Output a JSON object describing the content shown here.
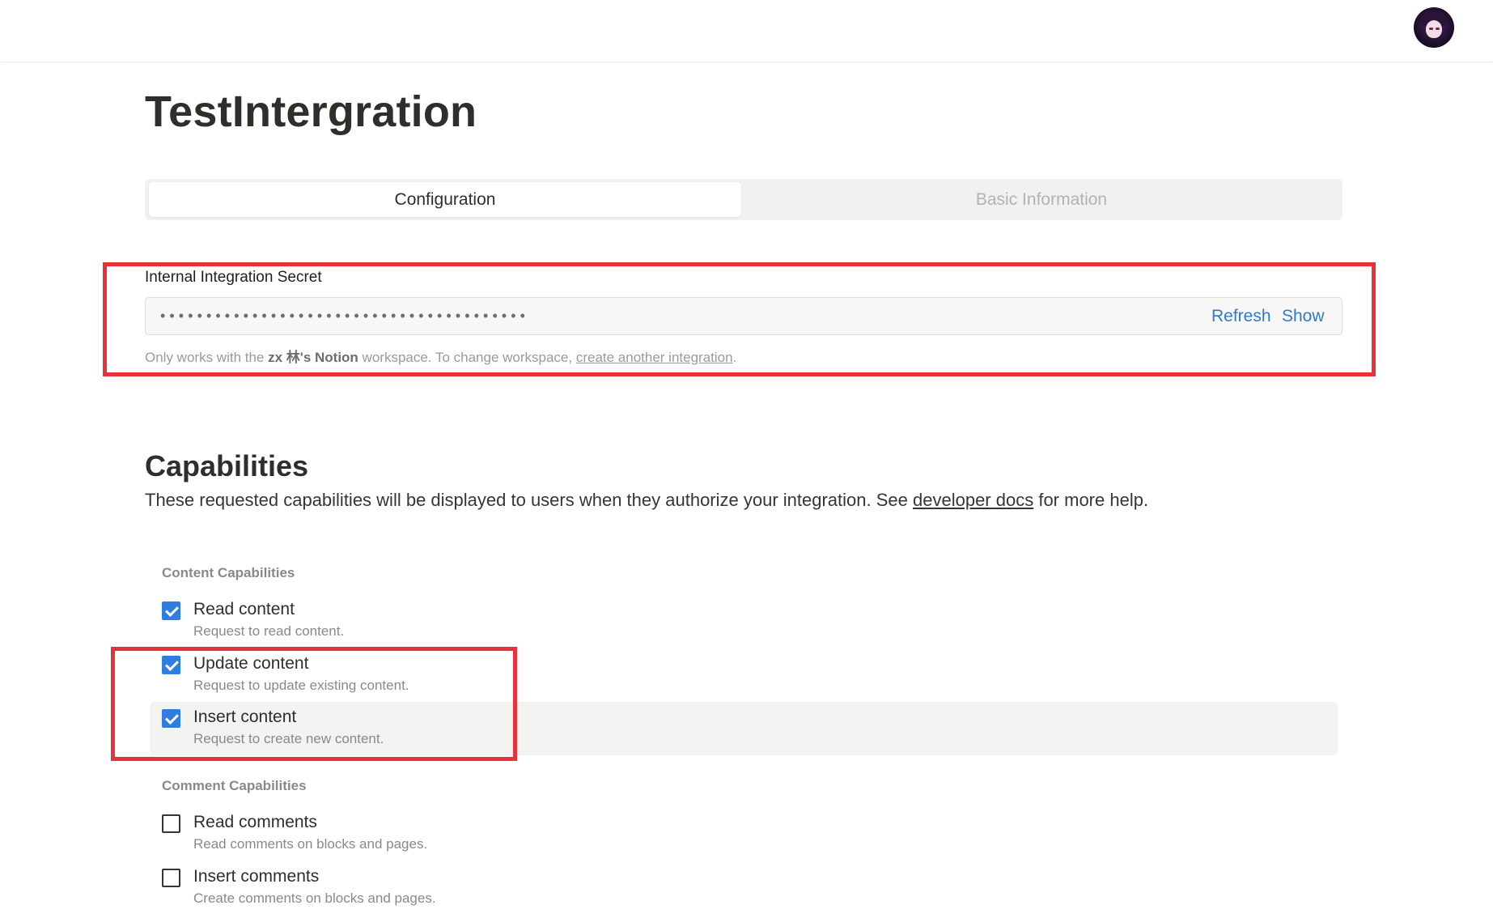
{
  "header": {
    "avatar_icon": "user-avatar"
  },
  "page": {
    "title": "TestIntergration"
  },
  "tabs": [
    {
      "label": "Configuration",
      "active": true
    },
    {
      "label": "Basic Information",
      "active": false
    }
  ],
  "secret": {
    "label": "Internal Integration Secret",
    "masked_value": "••••••••••••••••••••••••••••••••••••••••",
    "refresh_label": "Refresh",
    "show_label": "Show",
    "hint_prefix": "Only works with the ",
    "hint_workspace": "zx 林's Notion",
    "hint_middle": " workspace. To change workspace, ",
    "hint_link": "create another integration",
    "hint_suffix": "."
  },
  "capabilities": {
    "title": "Capabilities",
    "desc_prefix": "These requested capabilities will be displayed to users when they authorize your integration. See ",
    "desc_link": "developer docs",
    "desc_suffix": " for more help.",
    "content_group": {
      "label": "Content Capabilities",
      "items": [
        {
          "name": "Read content",
          "desc": "Request to read content.",
          "checked": true
        },
        {
          "name": "Update content",
          "desc": "Request to update existing content.",
          "checked": true
        },
        {
          "name": "Insert content",
          "desc": "Request to create new content.",
          "checked": true
        }
      ]
    },
    "comment_group": {
      "label": "Comment Capabilities",
      "items": [
        {
          "name": "Read comments",
          "desc": "Read comments on blocks and pages.",
          "checked": false
        },
        {
          "name": "Insert comments",
          "desc": "Create comments on blocks and pages.",
          "checked": false
        }
      ]
    }
  },
  "colors": {
    "accent": "#2f79d3",
    "checkbox": "#2f7de1",
    "annotation_red": "#e8323a"
  }
}
